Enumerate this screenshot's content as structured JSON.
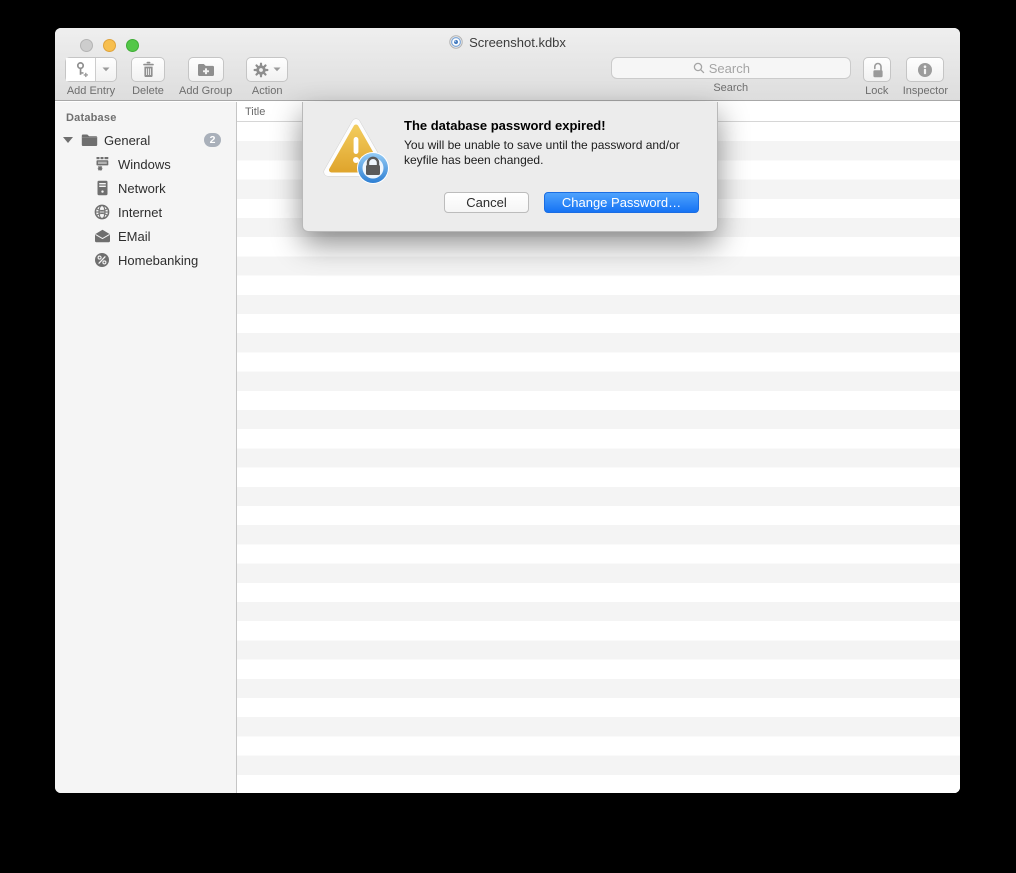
{
  "window": {
    "title": "Screenshot.kdbx"
  },
  "toolbar": {
    "add_entry_label": "Add Entry",
    "delete_label": "Delete",
    "add_group_label": "Add Group",
    "action_label": "Action",
    "search": {
      "placeholder": "Search",
      "label": "Search"
    },
    "lock_label": "Lock",
    "inspector_label": "Inspector"
  },
  "sidebar": {
    "header": "Database",
    "root": {
      "label": "General",
      "badge": "2",
      "icon": "folder-icon"
    },
    "items": [
      {
        "label": "Windows",
        "icon": "windows-group-icon"
      },
      {
        "label": "Network",
        "icon": "network-group-icon"
      },
      {
        "label": "Internet",
        "icon": "globe-icon"
      },
      {
        "label": "EMail",
        "icon": "envelope-icon"
      },
      {
        "label": "Homebanking",
        "icon": "percent-icon"
      }
    ]
  },
  "table": {
    "columns": [
      {
        "label": "Title"
      }
    ]
  },
  "dialog": {
    "title": "The database password expired!",
    "message": "You will be unable to save until the password and/or keyfile has been changed.",
    "cancel_label": "Cancel",
    "confirm_label": "Change Password…",
    "icon": "warning-lock-icon"
  },
  "colors": {
    "accent_blue": "#1d73f3",
    "warning_gold": "#eeb42f",
    "badge_gray": "#a9b0ba",
    "stripe_gray": "#f4f4f4"
  }
}
